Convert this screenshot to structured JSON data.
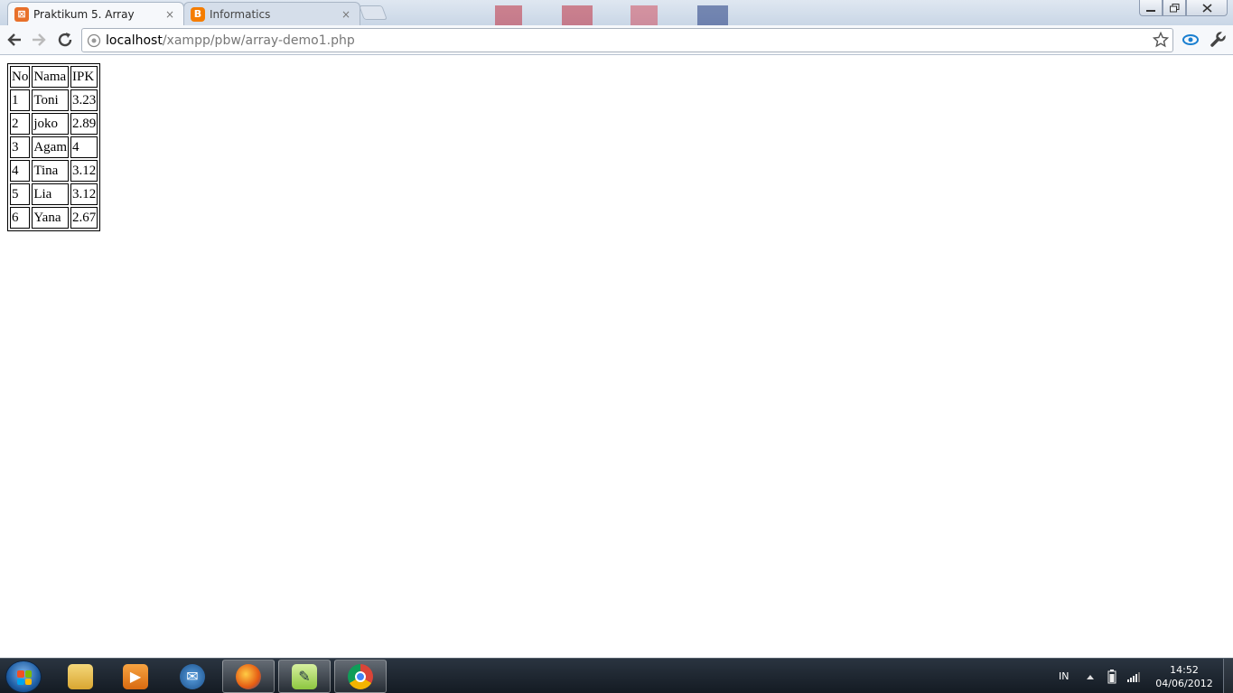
{
  "browser": {
    "tabs": [
      {
        "label": "Praktikum 5. Array",
        "favicon": "xampp-icon",
        "active": true
      },
      {
        "label": "Informatics",
        "favicon": "blogger-icon",
        "active": false
      }
    ],
    "close_glyph": "×",
    "url": {
      "host": "localhost",
      "path": "/xampp/pbw/array-demo1.php"
    }
  },
  "page": {
    "table": {
      "headers": [
        "No",
        "Nama",
        "IPK"
      ],
      "rows": [
        [
          "1",
          "Toni",
          "3.23"
        ],
        [
          "2",
          "joko",
          "2.89"
        ],
        [
          "3",
          "Agam",
          "4"
        ],
        [
          "4",
          "Tina",
          "3.12"
        ],
        [
          "5",
          "Lia",
          "3.12"
        ],
        [
          "6",
          "Yana",
          "2.67"
        ]
      ]
    }
  },
  "taskbar": {
    "apps": [
      "windows-explorer-icon",
      "media-player-icon",
      "thunderbird-icon",
      "firefox-icon",
      "notepad-plus-plus-icon",
      "chrome-icon"
    ],
    "language": "IN",
    "time": "14:52",
    "date": "04/06/2012"
  },
  "colors": {
    "xampp": "#e8702a",
    "blogger": "#f57d00",
    "taskbar": "#1b232c"
  }
}
